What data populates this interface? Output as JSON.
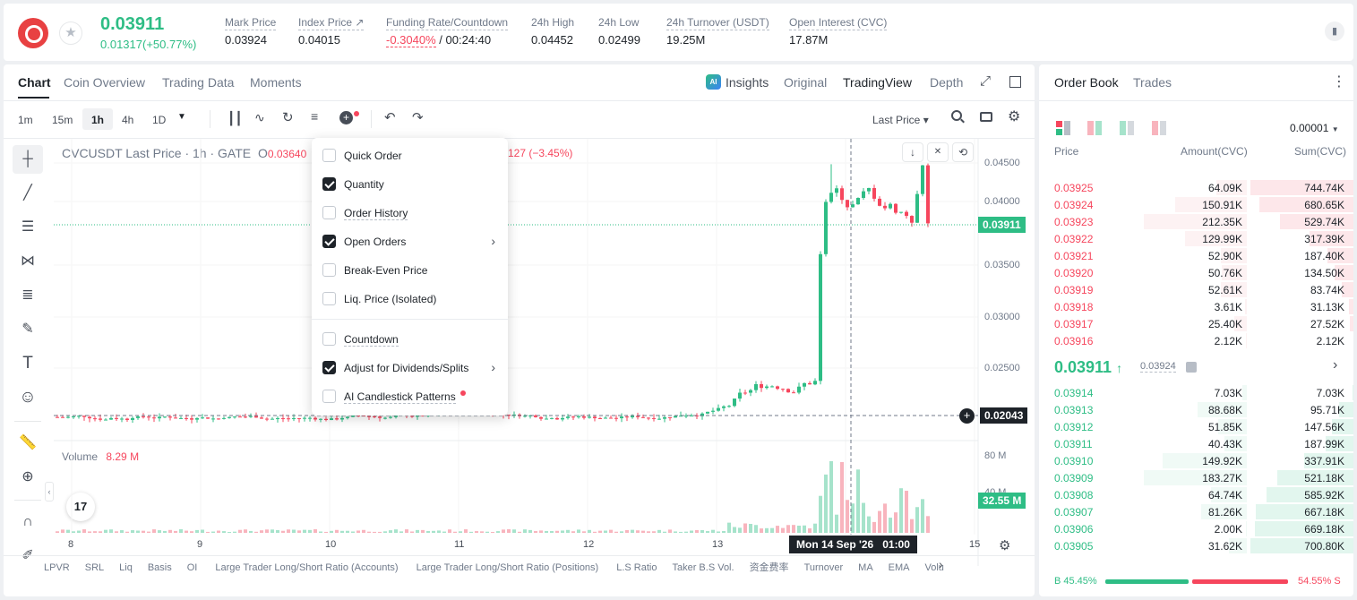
{
  "header": {
    "last_price": "0.03911",
    "change": "0.01317(+50.77%)",
    "stats": [
      {
        "label": "Mark Price",
        "value": "0.03924"
      },
      {
        "label": "Index Price ↗",
        "value": "0.04015"
      },
      {
        "label": "Funding Rate/Countdown",
        "value_red": "-0.3040%",
        "value": " / 00:24:40"
      },
      {
        "label": "24h High",
        "value": "0.04452"
      },
      {
        "label": "24h Low",
        "value": "0.02499"
      },
      {
        "label": "24h Turnover (USDT)",
        "value": "19.25M"
      },
      {
        "label": "Open Interest (CVC)",
        "value": "17.87M"
      }
    ]
  },
  "chart_tabs": [
    "Chart",
    "Coin Overview",
    "Trading Data",
    "Moments"
  ],
  "view_tabs": {
    "insights": "Insights",
    "original": "Original",
    "tradingview": "TradingView",
    "depth": "Depth"
  },
  "intervals": [
    "1m",
    "15m",
    "1h",
    "4h",
    "1D"
  ],
  "price_source": "Last Price ▾",
  "legend": {
    "symbol": "CVCUSDT Last Price · 1h · GATE",
    "ohlc_prefix": "O",
    "ohlc_open": "0.03640",
    "ohlc_tail": "127 (−3.45%)"
  },
  "volume": {
    "label": "Volume",
    "value": "8.29 M"
  },
  "price_axis": [
    "0.04500",
    "0.04000",
    "0.03500",
    "0.03000",
    "0.02500"
  ],
  "volume_axis": [
    "80 M",
    "40 M"
  ],
  "current_price_tag": "0.03911",
  "crosshair_price_tag": "0.02043",
  "volume_tag": "32.55 M",
  "time_axis": [
    "8",
    "9",
    "10",
    "11",
    "12",
    "13",
    "15"
  ],
  "crosshair_time": "Mon 14 Sep '26   01:00",
  "indicators": [
    "LPVR",
    "SRL",
    "Liq",
    "Basis",
    "OI",
    "Large Trader Long/Short Ratio (Accounts)",
    "Large Trader Long/Short Ratio (Positions)",
    "L.S Ratio",
    "Taker B.S Vol.",
    "资金费率",
    "Turnover",
    "MA",
    "EMA",
    "Volu"
  ],
  "menu": [
    {
      "label": "Quick Order",
      "checked": false
    },
    {
      "label": "Quantity",
      "checked": true
    },
    {
      "label": "Order History",
      "checked": false
    },
    {
      "label": "Open Orders",
      "checked": true,
      "submenu": true
    },
    {
      "label": "Break-Even Price",
      "checked": false
    },
    {
      "label": "Liq. Price (Isolated)",
      "checked": false
    },
    {
      "label": "Countdown",
      "checked": false
    },
    {
      "label": "Adjust for Dividends/Splits",
      "checked": true,
      "submenu": true
    },
    {
      "label": "AI Candlestick Patterns",
      "checked": false,
      "dot": true
    }
  ],
  "orderbook": {
    "tabs": [
      "Order Book",
      "Trades"
    ],
    "precision": "0.00001",
    "columns": [
      "Price",
      "Amount(CVC)",
      "Sum(CVC)"
    ],
    "asks": [
      {
        "price": "0.03925",
        "amount": "64.09K",
        "sum": "744.74K",
        "depth": 1.0,
        "amt": 0.3
      },
      {
        "price": "0.03924",
        "amount": "150.91K",
        "sum": "680.65K",
        "depth": 0.91,
        "amt": 0.7
      },
      {
        "price": "0.03923",
        "amount": "212.35K",
        "sum": "529.74K",
        "depth": 0.71,
        "amt": 1.0
      },
      {
        "price": "0.03922",
        "amount": "129.99K",
        "sum": "317.39K",
        "depth": 0.43,
        "amt": 0.6
      },
      {
        "price": "0.03921",
        "amount": "52.90K",
        "sum": "187.40K",
        "depth": 0.25,
        "amt": 0.25
      },
      {
        "price": "0.03920",
        "amount": "50.76K",
        "sum": "134.50K",
        "depth": 0.18,
        "amt": 0.24
      },
      {
        "price": "0.03919",
        "amount": "52.61K",
        "sum": "83.74K",
        "depth": 0.11,
        "amt": 0.25
      },
      {
        "price": "0.03918",
        "amount": "3.61K",
        "sum": "31.13K",
        "depth": 0.04,
        "amt": 0.02
      },
      {
        "price": "0.03917",
        "amount": "25.40K",
        "sum": "27.52K",
        "depth": 0.037,
        "amt": 0.12
      },
      {
        "price": "0.03916",
        "amount": "2.12K",
        "sum": "2.12K",
        "depth": 0.003,
        "amt": 0.01
      }
    ],
    "mid": {
      "price": "0.03911",
      "mark": "0.03924"
    },
    "bids": [
      {
        "price": "0.03914",
        "amount": "7.03K",
        "sum": "7.03K",
        "depth": 0.01,
        "amt": 0.04
      },
      {
        "price": "0.03913",
        "amount": "88.68K",
        "sum": "95.71K",
        "depth": 0.14,
        "amt": 0.48
      },
      {
        "price": "0.03912",
        "amount": "51.85K",
        "sum": "147.56K",
        "depth": 0.21,
        "amt": 0.28
      },
      {
        "price": "0.03911",
        "amount": "40.43K",
        "sum": "187.99K",
        "depth": 0.27,
        "amt": 0.22
      },
      {
        "price": "0.03910",
        "amount": "149.92K",
        "sum": "337.91K",
        "depth": 0.48,
        "amt": 0.82
      },
      {
        "price": "0.03909",
        "amount": "183.27K",
        "sum": "521.18K",
        "depth": 0.74,
        "amt": 1.0
      },
      {
        "price": "0.03908",
        "amount": "64.74K",
        "sum": "585.92K",
        "depth": 0.84,
        "amt": 0.35
      },
      {
        "price": "0.03907",
        "amount": "81.26K",
        "sum": "667.18K",
        "depth": 0.95,
        "amt": 0.44
      },
      {
        "price": "0.03906",
        "amount": "2.00K",
        "sum": "669.18K",
        "depth": 0.955,
        "amt": 0.01
      },
      {
        "price": "0.03905",
        "amount": "31.62K",
        "sum": "700.80K",
        "depth": 1.0,
        "amt": 0.17
      }
    ],
    "ratio": {
      "buy_label": "B 45.45%",
      "sell_label": "54.55% S",
      "buy": 0.4545
    }
  },
  "colors": {
    "up": "#2ebd85",
    "down": "#f6465d",
    "accent": "#1e2329"
  }
}
